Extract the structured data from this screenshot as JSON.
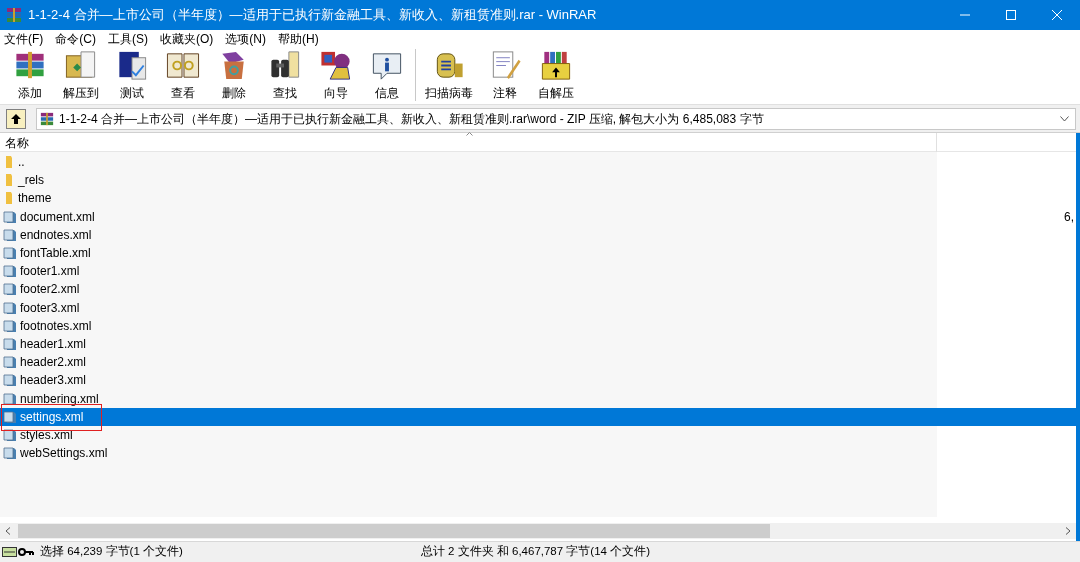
{
  "window": {
    "title": "1-1-2-4 合并—上市公司（半年度）—适用于已执行新金融工具、新收入、新租赁准则.rar - WinRAR"
  },
  "menu": [
    "文件(F)",
    "命令(C)",
    "工具(S)",
    "收藏夹(O)",
    "选项(N)",
    "帮助(H)"
  ],
  "toolbar": [
    {
      "label": "添加",
      "kind": "add"
    },
    {
      "label": "解压到",
      "kind": "extract"
    },
    {
      "label": "测试",
      "kind": "test"
    },
    {
      "label": "查看",
      "kind": "view"
    },
    {
      "label": "删除",
      "kind": "delete"
    },
    {
      "label": "查找",
      "kind": "find"
    },
    {
      "label": "向导",
      "kind": "wizard"
    },
    {
      "label": "信息",
      "kind": "info"
    },
    {
      "label": "扫描病毒",
      "kind": "scan",
      "group_start": true
    },
    {
      "label": "注释",
      "kind": "comment"
    },
    {
      "label": "自解压",
      "kind": "sfx"
    }
  ],
  "address": {
    "path": "1-1-2-4 合并—上市公司（半年度）—适用于已执行新金融工具、新收入、新租赁准则.rar\\word - ZIP 压缩, 解包大小为 6,485,083 字节"
  },
  "table": {
    "columns": [
      "名称"
    ],
    "rows": [
      {
        "name": "..",
        "kind": "folder",
        "selected": false,
        "marked": false
      },
      {
        "name": "_rels",
        "kind": "folder",
        "selected": false,
        "marked": false
      },
      {
        "name": "theme",
        "kind": "folder",
        "selected": false,
        "marked": false
      },
      {
        "name": "document.xml",
        "kind": "file",
        "column_2": "6,",
        "selected": false,
        "marked": false
      },
      {
        "name": "endnotes.xml",
        "kind": "file",
        "selected": false,
        "marked": false
      },
      {
        "name": "fontTable.xml",
        "kind": "file",
        "selected": false,
        "marked": false
      },
      {
        "name": "footer1.xml",
        "kind": "file",
        "selected": false,
        "marked": false
      },
      {
        "name": "footer2.xml",
        "kind": "file",
        "selected": false,
        "marked": false
      },
      {
        "name": "footer3.xml",
        "kind": "file",
        "selected": false,
        "marked": false
      },
      {
        "name": "footnotes.xml",
        "kind": "file",
        "selected": false,
        "marked": false
      },
      {
        "name": "header1.xml",
        "kind": "file",
        "selected": false,
        "marked": false
      },
      {
        "name": "header2.xml",
        "kind": "file",
        "selected": false,
        "marked": false
      },
      {
        "name": "header3.xml",
        "kind": "file",
        "selected": false,
        "marked": false
      },
      {
        "name": "numbering.xml",
        "kind": "file",
        "selected": false,
        "marked": false
      },
      {
        "name": "settings.xml",
        "kind": "file",
        "selected": true,
        "marked": true
      },
      {
        "name": "styles.xml",
        "kind": "file",
        "selected": false,
        "marked": false
      },
      {
        "name": "webSettings.xml",
        "kind": "file",
        "selected": false,
        "marked": false
      }
    ]
  },
  "status_bar": {
    "left": "选择 64,239 字节(1 个文件)",
    "right": "总计 2 文件夹 和 6,467,787 字节(14 个文件)"
  }
}
